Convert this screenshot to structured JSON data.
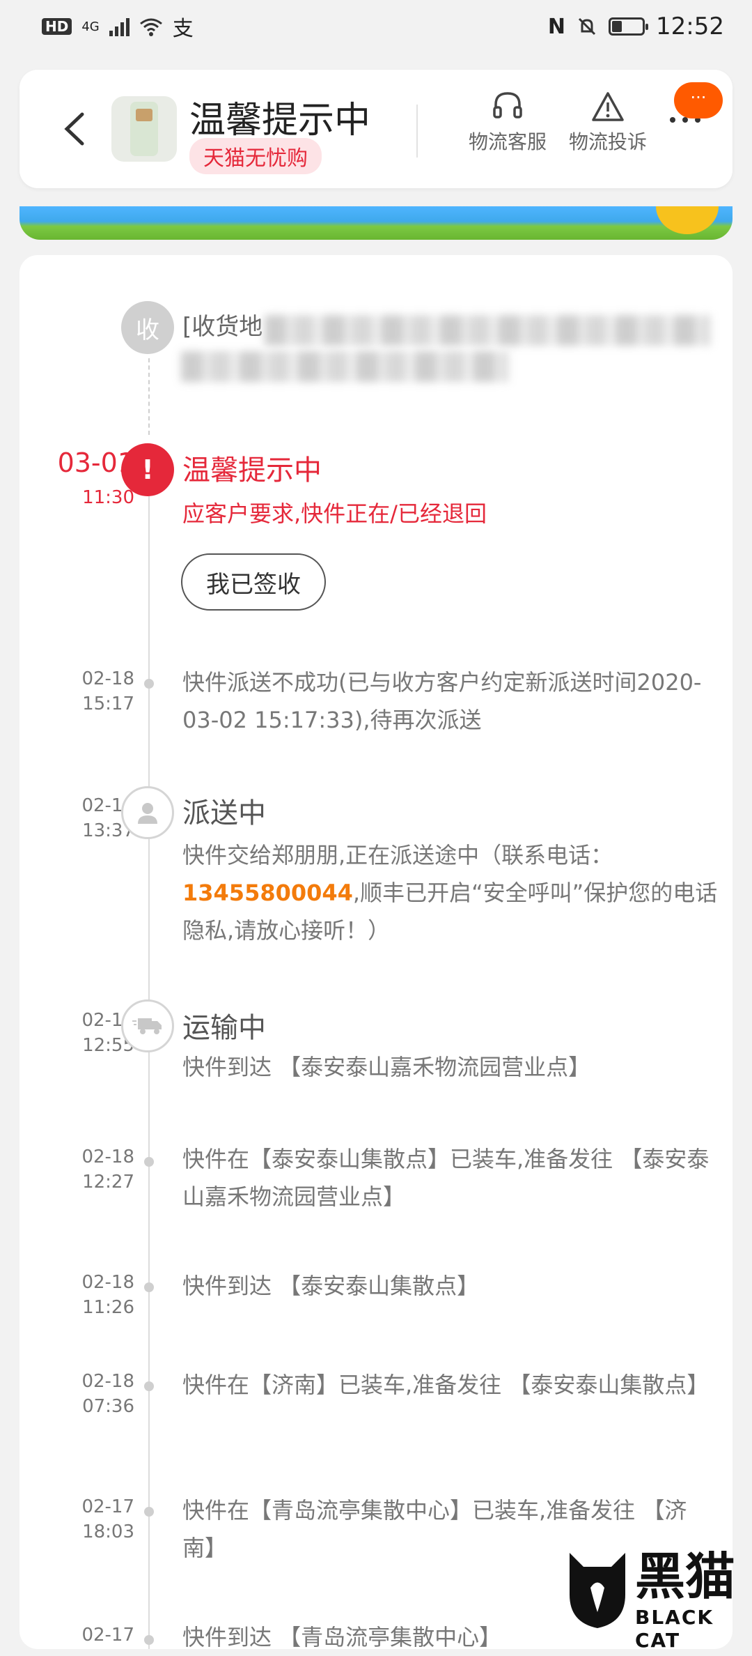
{
  "status_bar": {
    "hd": "HD",
    "network": "4G",
    "time": "12:52"
  },
  "header": {
    "title": "温馨提示中",
    "tag": "天猫无忧购",
    "service_label": "物流客服",
    "complaint_label": "物流投诉",
    "badge": "···"
  },
  "receiver": {
    "icon_text": "收",
    "label": "[收货地"
  },
  "events": [
    {
      "month_day": "03-01",
      "time": "11:30",
      "title": "温馨提示中",
      "desc": "应客户要求,快件正在/已经退回",
      "button": "我已签收"
    },
    {
      "month_day": "02-18",
      "time": "15:17",
      "desc": "快件派送不成功(已与收方客户约定新派送时间2020-03-02 15:17:33),待再次派送"
    },
    {
      "month_day": "02-18",
      "time": "13:37",
      "title": "派送中",
      "desc_before": "快件交给郑朋朋,正在派送途中（联系电话：",
      "phone": "13455800044",
      "desc_after": ",顺丰已开启“安全呼叫”保护您的电话隐私,请放心接听！）"
    },
    {
      "month_day": "02-18",
      "time": "12:55",
      "title": "运输中",
      "desc": "快件到达 【泰安泰山嘉禾物流园营业点】"
    },
    {
      "month_day": "02-18",
      "time": "12:27",
      "desc": "快件在【泰安泰山集散点】已装车,准备发往 【泰安泰山嘉禾物流园营业点】"
    },
    {
      "month_day": "02-18",
      "time": "11:26",
      "desc": "快件到达 【泰安泰山集散点】"
    },
    {
      "month_day": "02-18",
      "time": "07:36",
      "desc": "快件在【济南】已装车,准备发往 【泰安泰山集散点】"
    },
    {
      "month_day": "02-17",
      "time": "18:03",
      "desc": "快件在【青岛流亭集散中心】已装车,准备发往 【济南】"
    },
    {
      "month_day": "02-17",
      "time": "",
      "desc": "快件到达 【青岛流亭集散中心】"
    }
  ],
  "watermark": {
    "cn": "黑猫",
    "en": "BLACK CAT"
  },
  "colors": {
    "accent_red": "#e5283a",
    "phone_orange": "#f37b0b",
    "badge_orange": "#ff5a00"
  }
}
